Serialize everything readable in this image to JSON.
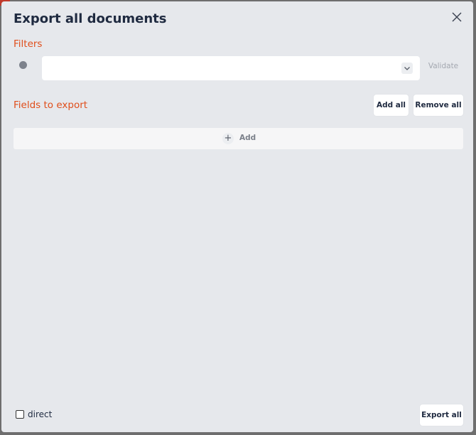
{
  "modal": {
    "title": "Export all documents",
    "close_icon": "close-icon"
  },
  "filters": {
    "label": "Filters",
    "select_value": "",
    "validate_label": "Validate"
  },
  "fields": {
    "label": "Fields to export",
    "add_all_label": "Add all",
    "remove_all_label": "Remove all",
    "add_label": "Add"
  },
  "footer": {
    "direct_label": "direct",
    "direct_checked": false,
    "export_label": "Export all"
  },
  "colors": {
    "accent": "#e04e1b",
    "title": "#1f2a40",
    "modal_bg": "#e6e8ec"
  }
}
